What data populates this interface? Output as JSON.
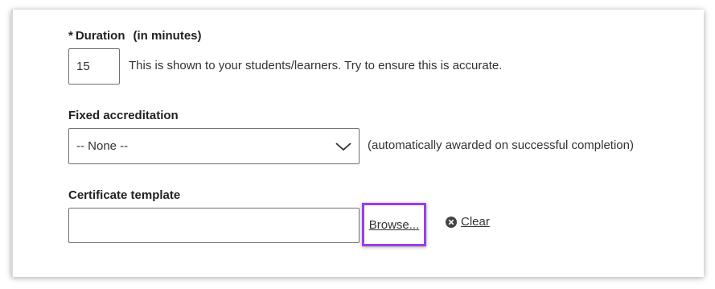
{
  "duration": {
    "required_mark": "*",
    "label": "Duration",
    "unit": "(in minutes)",
    "value": "15",
    "help": "This is shown to your students/learners. Try to ensure this is accurate."
  },
  "accreditation": {
    "label": "Fixed accreditation",
    "selected": "-- None --",
    "help": "(automatically awarded on successful completion)"
  },
  "certificate": {
    "label": "Certificate template",
    "browse_label": "Browse...",
    "clear_label": "Clear"
  },
  "colors": {
    "highlight": "#9b3ee8",
    "text": "#333333"
  },
  "icons": {
    "select": "chevron-down-icon",
    "clear": "close-circle-icon"
  }
}
